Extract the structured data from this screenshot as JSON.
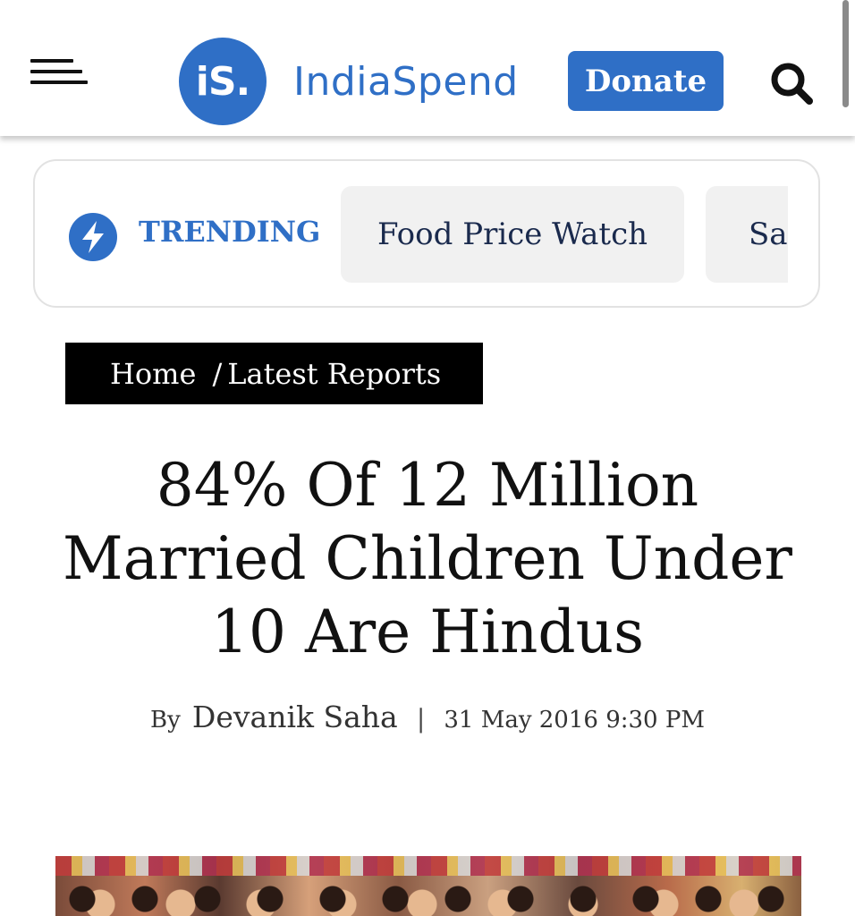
{
  "header": {
    "logo_mark": "iS.",
    "logo_text": "IndiaSpend",
    "donate_label": "Donate",
    "brand_color": "#2f6fc6",
    "menu_icon": "hamburger-menu-icon",
    "search_icon": "search-icon"
  },
  "trending": {
    "label": "TRENDING",
    "icon": "lightning-bolt-icon",
    "chips": [
      "Food Price Watch",
      "Saf"
    ]
  },
  "breadcrumb": {
    "items": [
      "Home",
      "Latest Reports"
    ],
    "separator": "/"
  },
  "article": {
    "title": "84% Of 12 Million Married Children Under 10 Are Hindus",
    "by_label": "By",
    "author": "Devanik Saha",
    "separator": "|",
    "date": "31 May 2016 9:30 PM"
  }
}
